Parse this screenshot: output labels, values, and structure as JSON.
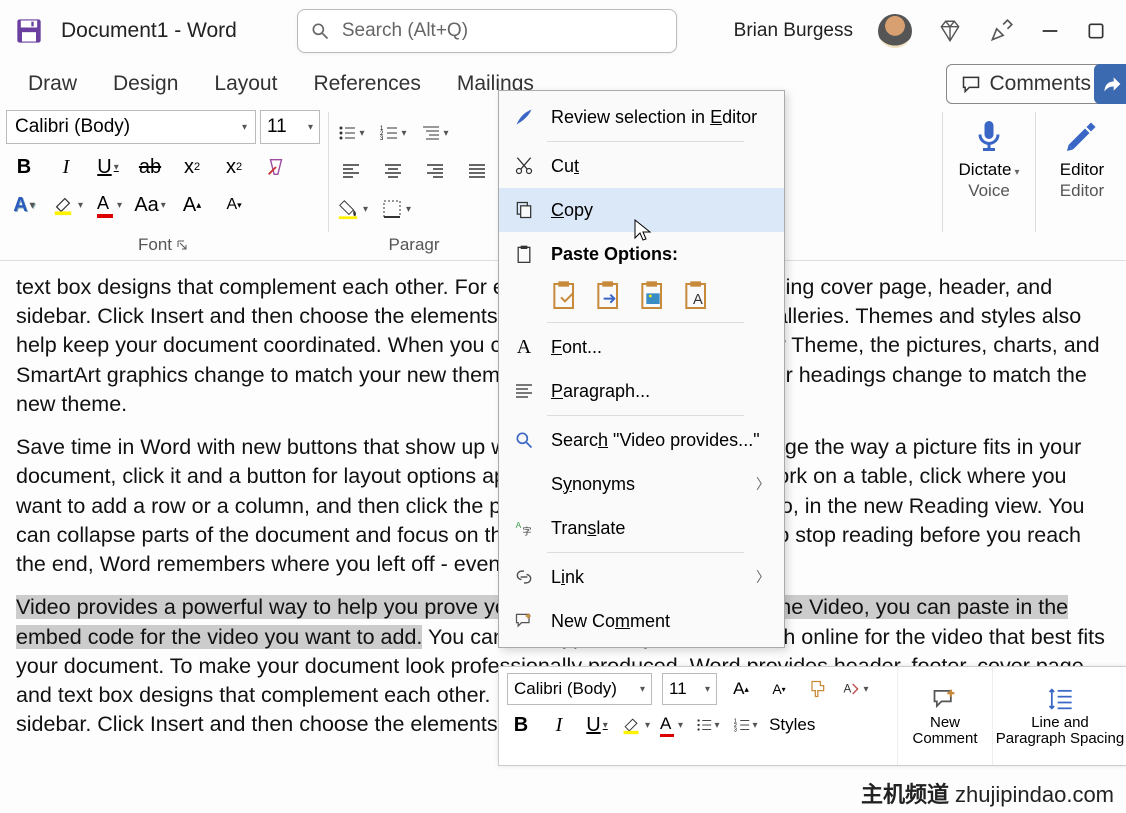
{
  "titlebar": {
    "doc_title": "Document1  -  Word",
    "search_placeholder": "Search (Alt+Q)",
    "user_name": "Brian Burgess"
  },
  "tabs": {
    "draw": "Draw",
    "design": "Design",
    "layout": "Layout",
    "references": "References",
    "mailings": "Mailings",
    "comments": "Comments"
  },
  "ribbon": {
    "font_name": "Calibri (Body)",
    "font_size": "11",
    "font_group": "Font",
    "para_group": "Paragr",
    "voice_group": "Voice",
    "editor_group": "Editor",
    "dictate": "Dictate",
    "editor": "Editor",
    "aa_case": "Aa"
  },
  "context_menu": {
    "review": "Review selection in Editor",
    "cut": "Cut",
    "copy": "Copy",
    "paste_options": "Paste Options:",
    "font": "Font...",
    "paragraph": "Paragraph...",
    "search": "Search \"Video provides...\"",
    "synonyms": "Synonyms",
    "translate": "Translate",
    "link": "Link",
    "new_comment": "New Comment"
  },
  "mini": {
    "font_name": "Calibri (Body)",
    "font_size": "11",
    "styles": "Styles",
    "new_comment": "New Comment",
    "line_spacing": "Line and Paragraph Spacing"
  },
  "document": {
    "p1": "text box designs that complement each other. For example, you can add a matching cover page, header, and sidebar. Click Insert and then choose the elements you want from the different galleries. Themes and styles also help keep your document coordinated. When you click Design and choose a new Theme, the pictures, charts, and SmartArt graphics change to match your new theme. When you apply styles, your headings change to match the new theme.",
    "p2": "Save time in Word with new buttons that show up where you need them. To change the way a picture fits in your document, click it and a button for layout options appears next to it. When you work on a table, click where you want to add a row or a column, and then click the plus sign. Reading is easier, too, in the new Reading view. You can collapse parts of the document and focus on the text you want. If you need to stop reading before you reach the end, Word remembers where you left off - even on another device.",
    "p3a": "Video provides a powerful way to help you prove your point. When you click Online Video, you can paste in the embed code for the video you want to add.",
    "p3b": " You can also type a keyword to search online for the video that best fits your document. To make your document look professionally produced, Word provides header, footer, cover page, and text box designs that complement each other. For example, you can add a matching cover page, header, and sidebar. Click Insert and then choose the elements you want from the different galleries."
  },
  "watermark_label": "主机频道",
  "watermark_url": "zhujipindao.com"
}
